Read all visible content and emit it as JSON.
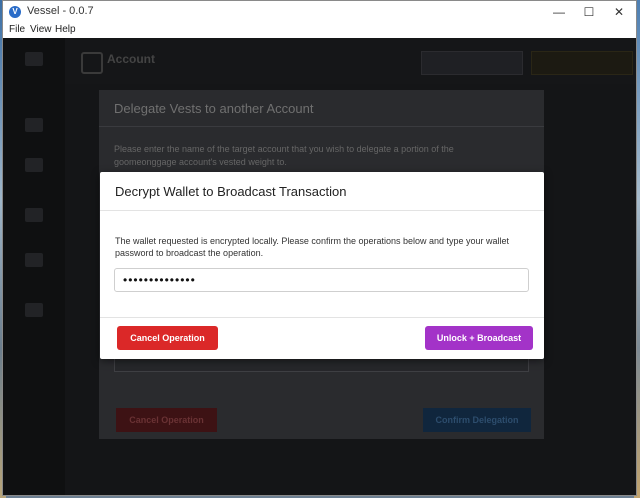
{
  "window": {
    "title": "Vessel - 0.0.7",
    "logo_letter": "V",
    "controls": {
      "minimize": "—",
      "maximize": "☐",
      "close": "✕"
    }
  },
  "menu": [
    "File",
    "View",
    "Help"
  ],
  "header": {
    "app_name": "Account"
  },
  "background_modal": {
    "title": "Delegate Vests to another Account",
    "description": "Please enter the name of the target account that you wish to delegate a portion of the goomeonggage account's vested weight to.",
    "cancel_label": "Cancel Operation",
    "confirm_label": "Confirm Delegation"
  },
  "modal": {
    "title": "Decrypt Wallet to Broadcast Transaction",
    "description": "The wallet requested is encrypted locally. Please confirm the operations below and type your wallet password to broadcast the operation.",
    "password_value": "••••••••••••••",
    "cancel_label": "Cancel Operation",
    "unlock_label": "Unlock + Broadcast"
  },
  "colors": {
    "cancel": "#db2828",
    "unlock": "#a333c8",
    "app_logo": "#2a6cc8"
  }
}
